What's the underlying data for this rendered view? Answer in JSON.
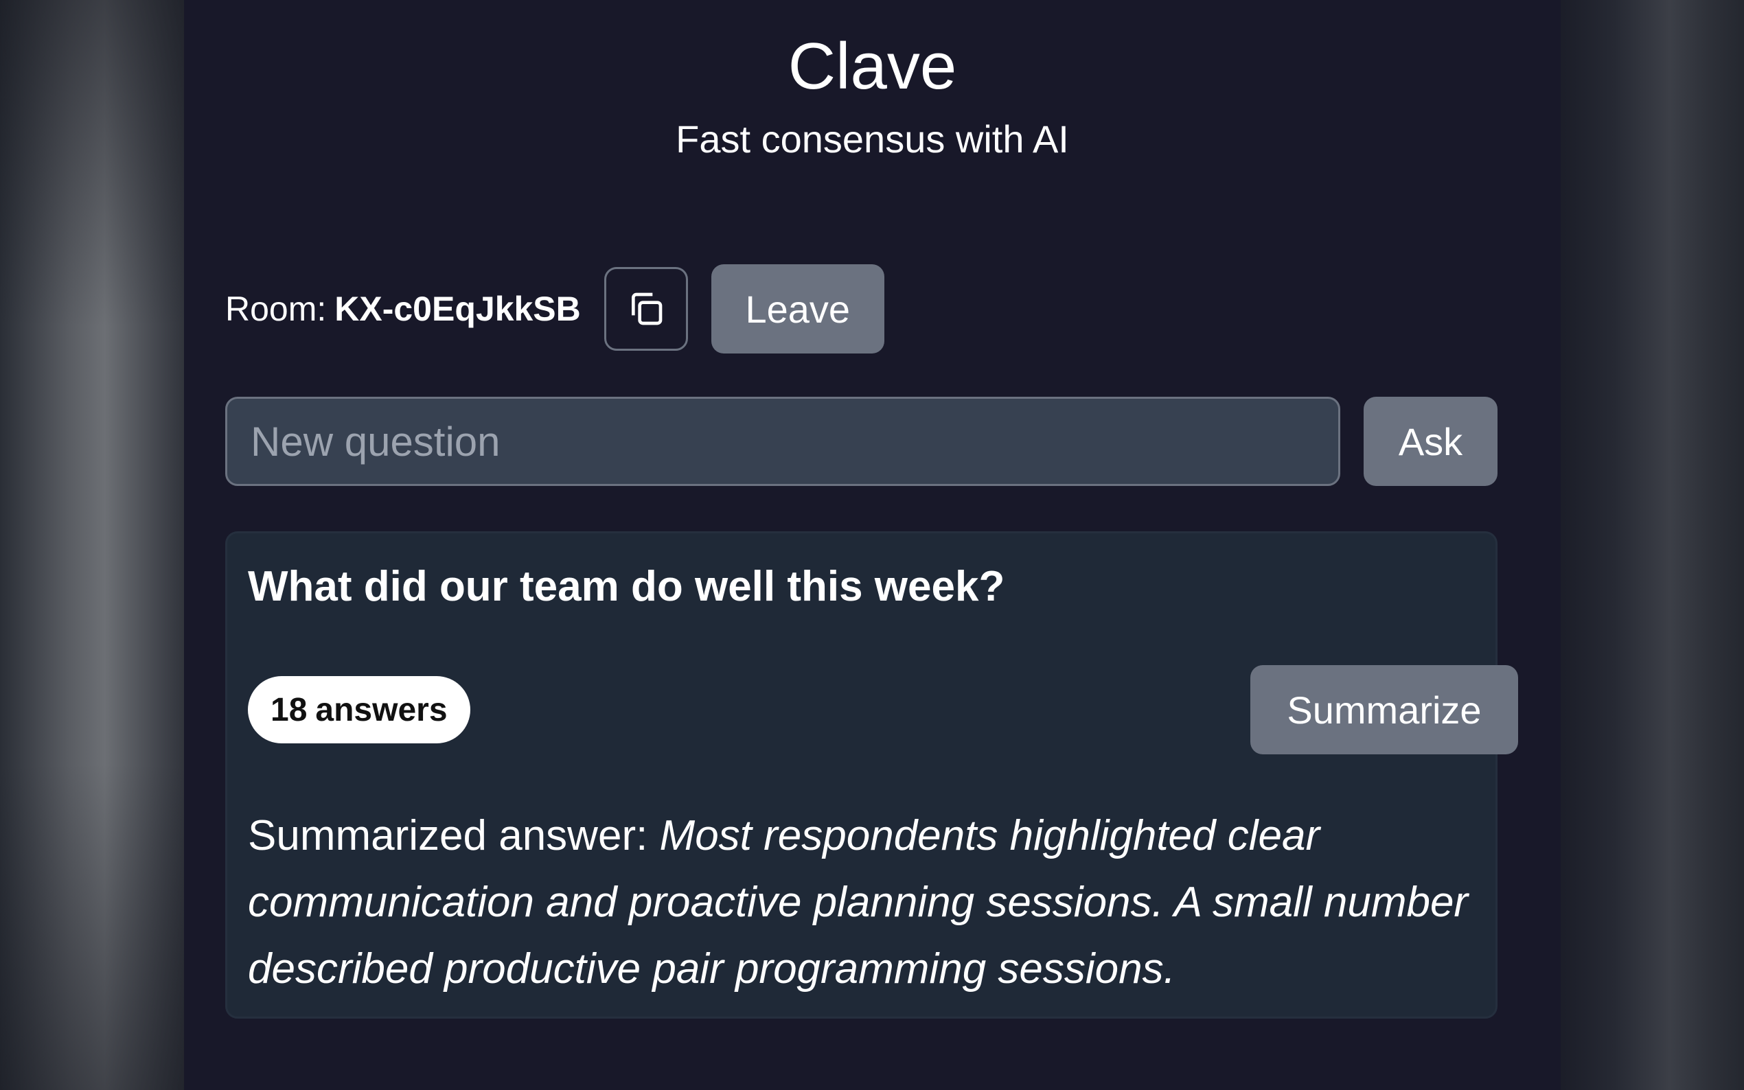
{
  "app": {
    "title": "Clave",
    "subtitle": "Fast consensus with AI"
  },
  "room": {
    "label": "Room:",
    "code": "KX-c0EqJkkSB",
    "copy_icon": "copy-icon",
    "leave_label": "Leave"
  },
  "ask_form": {
    "placeholder": "New question",
    "value": "",
    "ask_label": "Ask"
  },
  "question_card": {
    "question": "What did our team do well this week?",
    "answer_count": "18",
    "answer_count_label": "answers",
    "summarize_label": "Summarize",
    "summary_prefix": "Summarized answer:",
    "summary_text": "Most respondents highlighted clear communication and proactive planning sessions. A small number described productive pair programming sessions."
  },
  "colors": {
    "page_bg": "#181829",
    "card_bg": "#1f2937",
    "input_bg": "#374151",
    "button_bg": "#6b7280",
    "text": "#ffffff",
    "badge_bg": "#ffffff"
  }
}
